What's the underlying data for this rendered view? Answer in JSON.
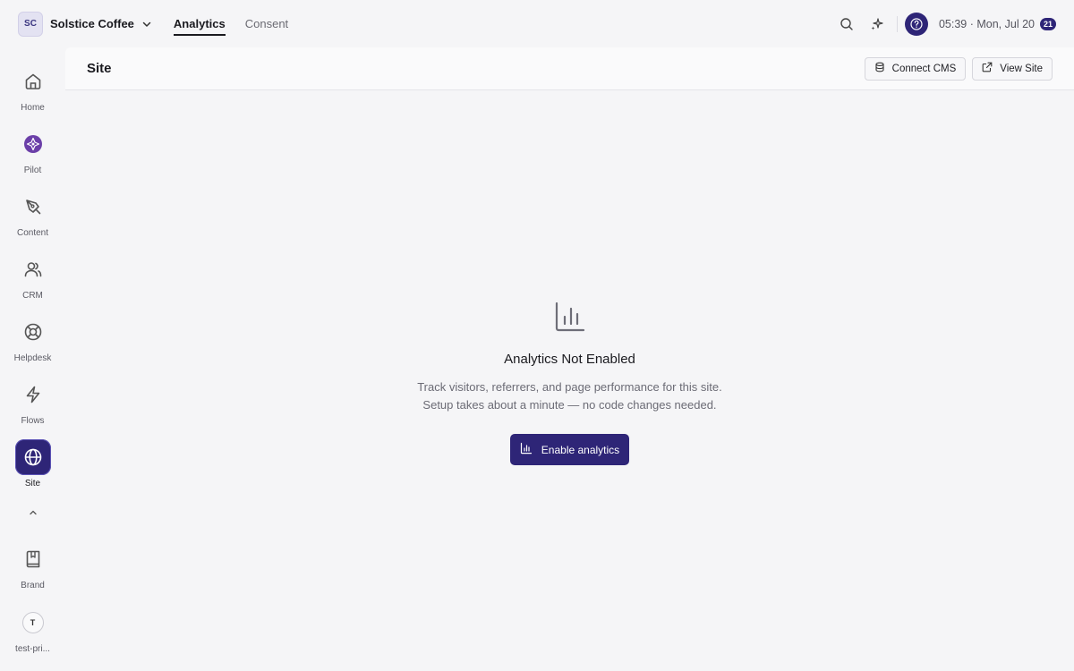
{
  "workspace": {
    "initials": "SC",
    "name": "Solstice Coffee"
  },
  "top_tabs": [
    {
      "label": "Analytics",
      "active": true
    },
    {
      "label": "Consent",
      "active": false
    }
  ],
  "clock": {
    "text": "05:39 · Mon, Jul 20",
    "badge": "21"
  },
  "sidebar": {
    "items": [
      {
        "label": "Home",
        "icon": "home-icon"
      },
      {
        "label": "Pilot",
        "icon": "pilot-icon"
      },
      {
        "label": "Content",
        "icon": "pen-icon"
      },
      {
        "label": "CRM",
        "icon": "users-icon"
      },
      {
        "label": "Helpdesk",
        "icon": "lifebuoy-icon"
      },
      {
        "label": "Flows",
        "icon": "bolt-icon"
      },
      {
        "label": "Site",
        "icon": "globe-icon",
        "active": true
      },
      {
        "label": "Brand",
        "icon": "book-icon"
      },
      {
        "label": "test-pri...",
        "icon": "user-avatar",
        "initial": "T"
      }
    ]
  },
  "page": {
    "title": "Site",
    "actions": {
      "connect_cms": "Connect CMS",
      "view_site": "View Site"
    }
  },
  "empty_state": {
    "title": "Analytics Not Enabled",
    "line1": "Track visitors, referrers, and page performance for this site.",
    "line2": "Setup takes about a minute — no code changes needed.",
    "cta": "Enable analytics"
  },
  "colors": {
    "accent": "#2e2577",
    "pilot": "#6b3fa8"
  }
}
